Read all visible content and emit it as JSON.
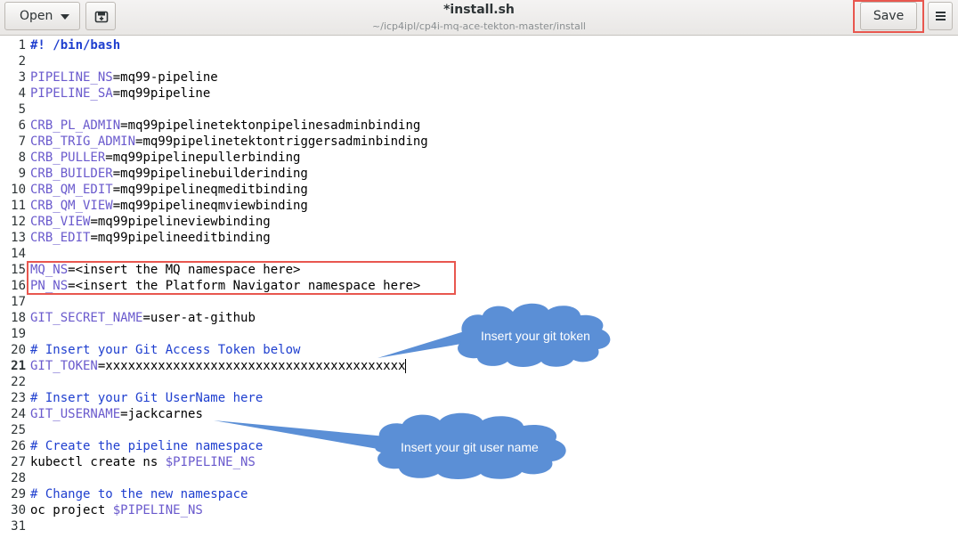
{
  "header": {
    "open_label": "Open",
    "title": "*install.sh",
    "path": "~/icp4ipl/cp4i-mq-ace-tekton-master/install",
    "save_label": "Save"
  },
  "editor": {
    "lines": [
      {
        "num": "1",
        "key": "",
        "rest": "#! /bin/bash"
      },
      {
        "num": "2",
        "key": "",
        "rest": ""
      },
      {
        "num": "3",
        "key": "PIPELINE_NS",
        "rest": "=mq99-pipeline"
      },
      {
        "num": "4",
        "key": "PIPELINE_SA",
        "rest": "=mq99pipeline"
      },
      {
        "num": "5",
        "key": "",
        "rest": ""
      },
      {
        "num": "6",
        "key": "CRB_PL_ADMIN",
        "rest": "=mq99pipelinetektonpipelinesadminbinding"
      },
      {
        "num": "7",
        "key": "CRB_TRIG_ADMIN",
        "rest": "=mq99pipelinetektontriggersadminbinding"
      },
      {
        "num": "8",
        "key": "CRB_PULLER",
        "rest": "=mq99pipelinepullerbinding"
      },
      {
        "num": "9",
        "key": "CRB_BUILDER",
        "rest": "=mq99pipelinebuilderinding"
      },
      {
        "num": "10",
        "key": "CRB_QM_EDIT",
        "rest": "=mq99pipelineqmeditbinding"
      },
      {
        "num": "11",
        "key": "CRB_QM_VIEW",
        "rest": "=mq99pipelineqmviewbinding"
      },
      {
        "num": "12",
        "key": "CRB_VIEW",
        "rest": "=mq99pipelineviewbinding"
      },
      {
        "num": "13",
        "key": "CRB_EDIT",
        "rest": "=mq99pipelineeditbinding"
      },
      {
        "num": "14",
        "key": "",
        "rest": ""
      },
      {
        "num": "15",
        "key": "MQ_NS",
        "rest": "=<insert the MQ namespace here>"
      },
      {
        "num": "16",
        "key": "PN_NS",
        "rest": "=<insert the Platform Navigator namespace here>"
      },
      {
        "num": "17",
        "key": "",
        "rest": ""
      },
      {
        "num": "18",
        "key": "GIT_SECRET_NAME",
        "rest": "=user-at-github"
      },
      {
        "num": "19",
        "key": "",
        "rest": ""
      },
      {
        "num": "20",
        "key": "",
        "rest": "# Insert your Git Access Token below"
      },
      {
        "num": "21",
        "key": "GIT_TOKEN",
        "rest": "=xxxxxxxxxxxxxxxxxxxxxxxxxxxxxxxxxxxxxxxx"
      },
      {
        "num": "22",
        "key": "",
        "rest": ""
      },
      {
        "num": "23",
        "key": "",
        "rest": "# Insert your Git UserName here"
      },
      {
        "num": "24",
        "key": "GIT_USERNAME",
        "rest": "=jackcarnes"
      },
      {
        "num": "25",
        "key": "",
        "rest": ""
      },
      {
        "num": "26",
        "key": "",
        "rest": "# Create the pipeline namespace"
      },
      {
        "num": "27",
        "key": "",
        "rest": "kubectl create ns ",
        "tail": "$PIPELINE_NS"
      },
      {
        "num": "28",
        "key": "",
        "rest": ""
      },
      {
        "num": "29",
        "key": "",
        "rest": "# Change to the new namespace"
      },
      {
        "num": "30",
        "key": "",
        "rest": "oc project ",
        "tail": "$PIPELINE_NS"
      },
      {
        "num": "31",
        "key": "",
        "rest": ""
      }
    ]
  },
  "callouts": {
    "token": "Insert your git token",
    "username": "Insert your git user name"
  },
  "colors": {
    "highlight_box": "#e8574f",
    "callout_fill": "#5b8fd6",
    "variable": "#6a5acd",
    "comment": "#1f3fcf"
  },
  "icons": {
    "open_caret": "chevron-down-icon",
    "new_doc": "new-document-icon",
    "menu": "hamburger-menu-icon"
  }
}
